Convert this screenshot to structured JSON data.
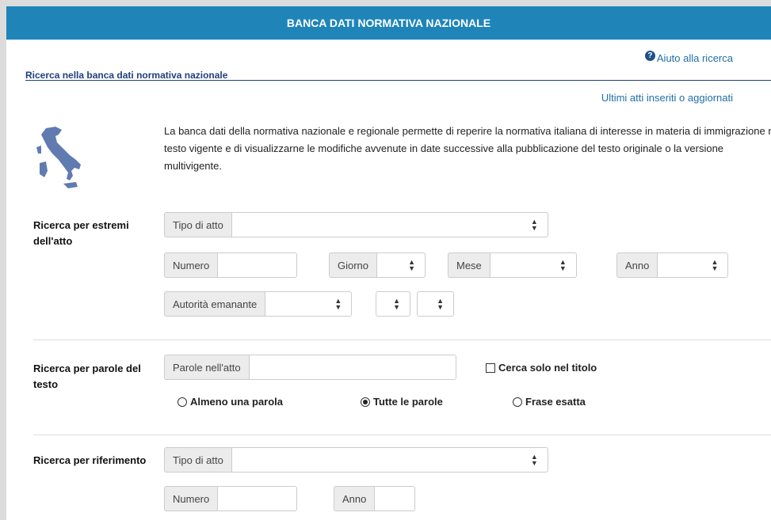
{
  "banner": {
    "title": "BANCA DATI NORMATIVA NAZIONALE"
  },
  "help": {
    "icon": "question-circle-icon",
    "label": "Aiuto alla ricerca"
  },
  "section": {
    "title": "Ricerca nella banca dati normativa nazionale"
  },
  "latest_link": "Ultimi atti inseriti o aggiornati",
  "intro": {
    "map_icon": "italy-map-icon",
    "text": "La banca dati della normativa nazionale e regionale permette di reperire la normativa italiana di interesse in materia di immigrazione nel testo vigente e di visualizzarne le modifiche avvenute in date successive alla pubblicazione del testo originale o la versione multivigente."
  },
  "estremi": {
    "label": "Ricerca per estremi dell'atto",
    "tipo_atto": "Tipo di atto",
    "numero": "Numero",
    "giorno": "Giorno",
    "mese": "Mese",
    "anno": "Anno",
    "autorita": "Autorità emanante"
  },
  "parole": {
    "label": "Ricerca per parole del testo",
    "parole_atto": "Parole nell'atto",
    "solo_titolo": "Cerca solo nel titolo",
    "options": [
      {
        "label": "Almeno una parola",
        "selected": false
      },
      {
        "label": "Tutte le parole",
        "selected": true
      },
      {
        "label": "Frase esatta",
        "selected": false
      }
    ]
  },
  "riferimento": {
    "label": "Ricerca per riferimento",
    "tipo_atto": "Tipo di atto",
    "numero": "Numero",
    "anno": "Anno"
  },
  "colors": {
    "banner": "#1f85b8",
    "link": "#1f6fa8",
    "title": "#1f3f7a"
  }
}
